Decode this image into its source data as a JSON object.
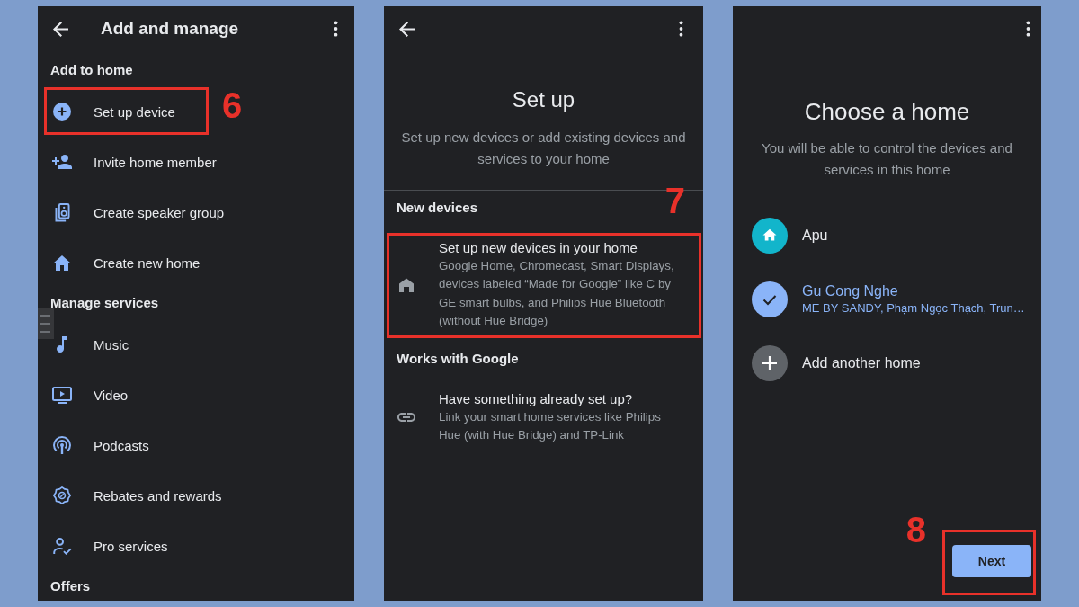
{
  "screens": [
    {
      "kind": "menu",
      "title": "Add and manage",
      "sections": [
        {
          "heading": "Add to home",
          "items": [
            {
              "label": "Set up device",
              "callout": "6"
            },
            {
              "label": "Invite home member"
            },
            {
              "label": "Create speaker group"
            },
            {
              "label": "Create new home"
            }
          ]
        },
        {
          "heading": "Manage services",
          "items": [
            {
              "label": "Music"
            },
            {
              "label": "Video"
            },
            {
              "label": "Podcasts"
            },
            {
              "label": "Rebates and rewards"
            },
            {
              "label": "Pro services"
            }
          ]
        },
        {
          "heading": "Offers"
        }
      ]
    },
    {
      "kind": "setup",
      "title": "Set up",
      "subtitle": "Set up new devices or add existing devices and services to your home",
      "sections": [
        {
          "heading": "New devices",
          "items": [
            {
              "title": "Set up new devices in your home",
              "description": "Google Home, Chromecast, Smart Displays, devices labeled “Made for Google” like C by GE smart bulbs, and Philips Hue Bluetooth (without Hue Bridge)",
              "callout": "7"
            }
          ]
        },
        {
          "heading": "Works with Google",
          "items": [
            {
              "title": "Have something already set up?",
              "description": "Link your smart home services like Philips Hue (with Hue Bridge) and TP-Link"
            }
          ]
        }
      ]
    },
    {
      "kind": "chooser",
      "title": "Choose a home",
      "subtitle": "You will be able to control the devices and services in this home",
      "homes": [
        {
          "name": "Apu",
          "selected": false
        },
        {
          "name": "Gu Cong Nghe",
          "address": "ME BY SANDY, Phạm Ngọc Thạch, Trun…",
          "selected": true
        }
      ],
      "add_home": {
        "label": "Add another home"
      },
      "button": {
        "label": "Next",
        "callout": "8"
      }
    }
  ]
}
